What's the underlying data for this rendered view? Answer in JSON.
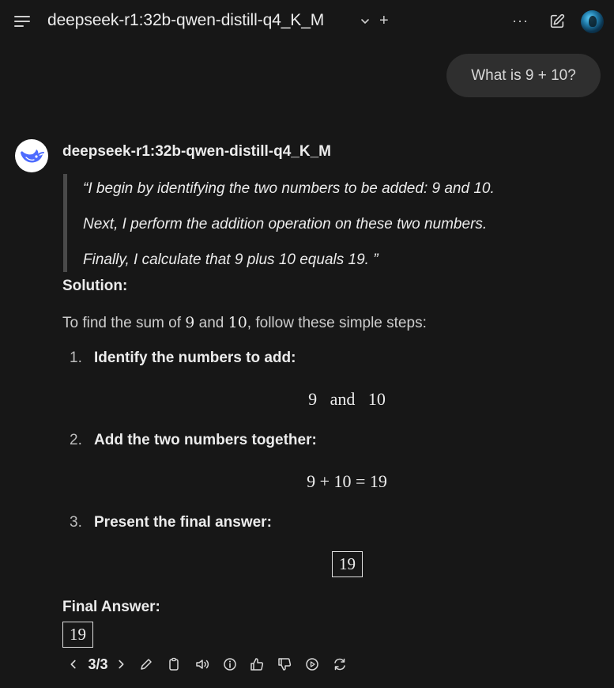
{
  "header": {
    "model_title": "deepseek-r1:32b-qwen-distill-q4_K_M",
    "plus": "+",
    "more": "···"
  },
  "user_message": "What is 9 + 10?",
  "assistant": {
    "name": "deepseek-r1:32b-qwen-distill-q4_K_M",
    "thinking": [
      "“I begin by identifying the two numbers to be added: 9 and 10.",
      "Next, I perform the addition operation on these two numbers.",
      "Finally, I calculate that 9 plus 10 equals 19. ”"
    ],
    "solution_heading": "Solution:",
    "intro": {
      "before": "To find the sum of ",
      "a": "9",
      "mid": " and ",
      "b": "10",
      "after": ", follow these simple steps:"
    },
    "steps": [
      {
        "num": "1.",
        "text": "Identify the numbers to add:",
        "math": "9   and   10"
      },
      {
        "num": "2.",
        "text": "Add the two numbers together:",
        "math": "9 + 10 = 19"
      },
      {
        "num": "3.",
        "text": "Present the final answer:",
        "math": "19"
      }
    ],
    "final_heading": "Final Answer:",
    "final_value": "19"
  },
  "toolbar": {
    "pager": "3/3",
    "icons": [
      "chevron-left-icon",
      "chevron-right-icon",
      "pencil-icon",
      "clipboard-icon",
      "speaker-icon",
      "info-icon",
      "thumbs-up-icon",
      "thumbs-down-icon",
      "play-circle-icon",
      "regenerate-icon"
    ]
  },
  "colors": {
    "background": "#171717",
    "bubble": "#2f2f2f",
    "text": "#ececec",
    "quote_bar": "#4a4a4a"
  }
}
